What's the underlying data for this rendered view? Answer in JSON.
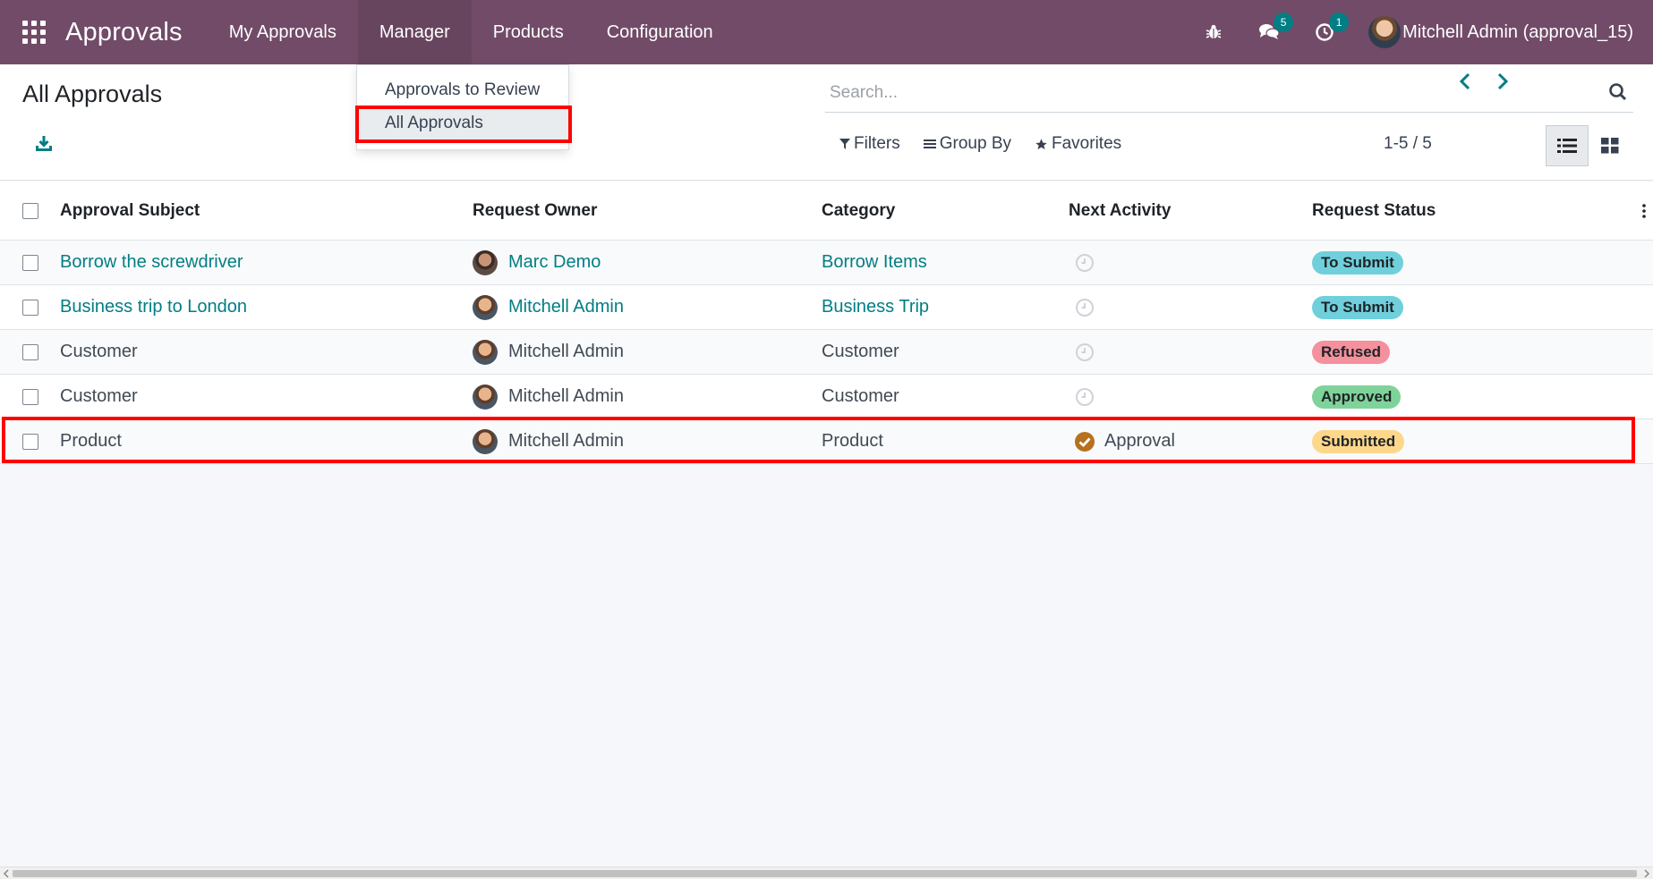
{
  "navbar": {
    "brand": "Approvals",
    "menu": [
      {
        "label": "My Approvals"
      },
      {
        "label": "Manager"
      },
      {
        "label": "Products"
      },
      {
        "label": "Configuration"
      }
    ],
    "messages_count": "5",
    "activities_count": "1",
    "user_name": "Mitchell Admin (approval_15)"
  },
  "dropdown": {
    "items": [
      {
        "label": "Approvals to Review"
      },
      {
        "label": "All Approvals"
      }
    ]
  },
  "control_panel": {
    "title": "All Approvals",
    "search_placeholder": "Search...",
    "filters_label": "Filters",
    "group_by_label": "Group By",
    "favorites_label": "Favorites",
    "pager": "1-5 / 5"
  },
  "table": {
    "columns": [
      "Approval Subject",
      "Request Owner",
      "Category",
      "Next Activity",
      "Request Status"
    ],
    "rows": [
      {
        "subject": "Borrow the screwdriver",
        "owner": "Marc Demo",
        "category": "Borrow Items",
        "activity": "",
        "status": "To Submit"
      },
      {
        "subject": "Business trip to London",
        "owner": "Mitchell Admin",
        "category": "Business Trip",
        "activity": "",
        "status": "To Submit"
      },
      {
        "subject": "Customer",
        "owner": "Mitchell Admin",
        "category": "Customer",
        "activity": "",
        "status": "Refused"
      },
      {
        "subject": "Customer",
        "owner": "Mitchell Admin",
        "category": "Customer",
        "activity": "",
        "status": "Approved"
      },
      {
        "subject": "Product",
        "owner": "Mitchell Admin",
        "category": "Product",
        "activity": "Approval",
        "status": "Submitted"
      }
    ]
  },
  "colors": {
    "navbar": "#714b67",
    "link": "#017e84",
    "status_to_submit": "#6fd0dc",
    "status_refused": "#f5909d",
    "status_approved": "#7fd39a",
    "status_submitted": "#fdd78a",
    "activity_done": "#b6711e",
    "highlight": "#ff0000"
  }
}
